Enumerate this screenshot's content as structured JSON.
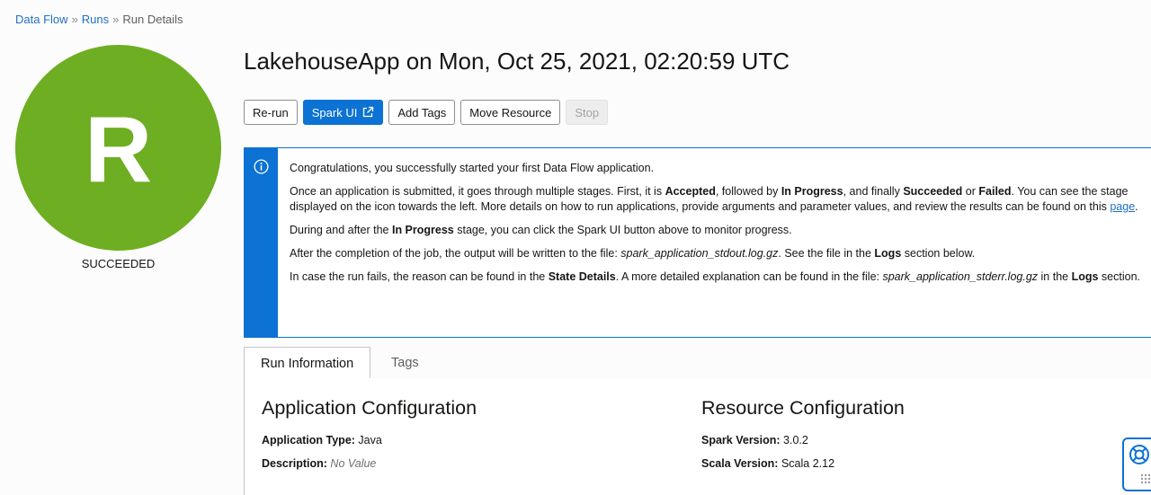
{
  "breadcrumb": {
    "items": [
      "Data Flow",
      "Runs",
      "Run Details"
    ],
    "separator": "»"
  },
  "status": {
    "letter": "R",
    "label": "SUCCEEDED",
    "color": "#6eae22"
  },
  "title": "LakehouseApp on Mon, Oct 25, 2021, 02:20:59 UTC",
  "actions": {
    "rerun": "Re-run",
    "spark_ui": "Spark UI",
    "add_tags": "Add Tags",
    "move_resource": "Move Resource",
    "stop": "Stop"
  },
  "info": {
    "icon": "info-icon",
    "p1": "Congratulations, you successfully started your first Data Flow application.",
    "p2": {
      "a": "Once an application is submitted, it goes through multiple stages. First, it is ",
      "b": "Accepted",
      "c": ", followed by ",
      "d": "In Progress",
      "e": ", and finally ",
      "f": "Succeeded",
      "g": " or ",
      "h": "Failed",
      "i": ". You can see the stage displayed on the icon towards the left. More details on how to run applications, provide arguments and parameter values, and review the results can be found on this ",
      "link": "page",
      "j": "."
    },
    "p3": {
      "a": "During and after the ",
      "b": "In Progress",
      "c": " stage, you can click the Spark UI button above to monitor progress."
    },
    "p4": {
      "a": "After the completion of the job, the output will be written to the file: ",
      "b": "spark_application_stdout.log.gz",
      "c": ". See the file in the ",
      "d": "Logs",
      "e": " section below."
    },
    "p5": {
      "a": "In case the run fails, the reason can be found in the ",
      "b": "State Details",
      "c": ". A more detailed explanation can be found in the file: ",
      "d": "spark_application_stderr.log.gz",
      "e": " in the ",
      "f": "Logs",
      "g": " section."
    }
  },
  "tabs": [
    "Run Information",
    "Tags"
  ],
  "app_config": {
    "title": "Application Configuration",
    "type_label": "Application Type:",
    "type_value": "Java",
    "desc_label": "Description:",
    "desc_value": "No Value"
  },
  "resource_config": {
    "title": "Resource Configuration",
    "spark_label": "Spark Version:",
    "spark_value": "3.0.2",
    "scala_label": "Scala Version:",
    "scala_value": "Scala 2.12"
  },
  "help": {
    "icon": "lifebuoy-icon"
  }
}
